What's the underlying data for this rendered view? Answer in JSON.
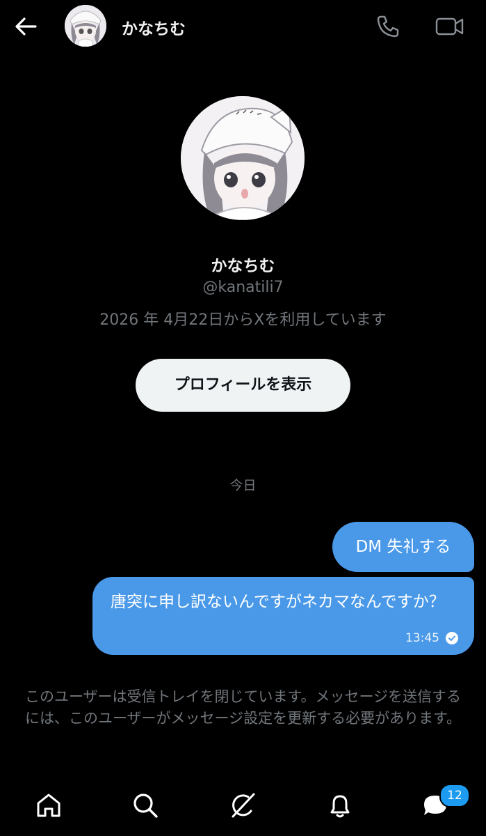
{
  "header": {
    "name": "かなちむ",
    "icons": [
      "back-arrow-icon",
      "phone-icon",
      "video-icon"
    ]
  },
  "profile": {
    "name": "かなちむ",
    "handle": "@kanatili7",
    "joined": "2026 年 4月22日からXを利用しています",
    "view_profile_label": "プロフィールを表示"
  },
  "conversation": {
    "date_separator": "今日",
    "messages": [
      {
        "text": "DM 失礼する",
        "from": "me"
      },
      {
        "text": "唐突に申し訳ないんですがネカマなんですか？",
        "from": "me",
        "time": "13:45",
        "status": "read"
      }
    ]
  },
  "closed_notice": "このユーザーは受信トレイを閉じています。メッセージを送信するには、このユーザーがメッセージ設定を更新する必要があります。",
  "bottom_nav": {
    "items": [
      "home-icon",
      "search-icon",
      "grok-icon",
      "notifications-icon",
      "messages-icon"
    ],
    "messages_badge": "12"
  },
  "colors": {
    "background": "#000000",
    "bubble": "#4a99e9",
    "muted_text": "#71767b",
    "badge": "#1d9bf0"
  }
}
